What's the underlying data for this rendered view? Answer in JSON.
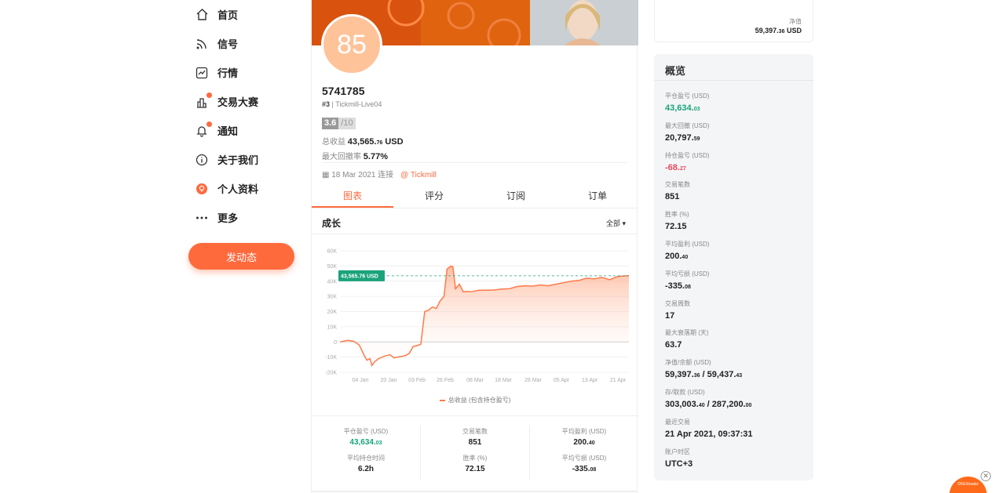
{
  "nav": {
    "items": [
      {
        "label": "首页",
        "icon": "home-icon"
      },
      {
        "label": "信号",
        "icon": "rss-icon"
      },
      {
        "label": "行情",
        "icon": "chart-icon"
      },
      {
        "label": "交易大赛",
        "icon": "trophy-icon"
      },
      {
        "label": "通知",
        "icon": "bell-icon"
      },
      {
        "label": "关于我们",
        "icon": "info-icon"
      },
      {
        "label": "个人资料",
        "icon": "profile-icon"
      },
      {
        "label": "更多",
        "icon": "more-icon"
      }
    ],
    "post_button": "发动态"
  },
  "profile": {
    "score_avatar": "85",
    "account_id": "5741785",
    "rank": "#3",
    "server": "Tickmill-Live04",
    "rating": "3.6",
    "rating_max": "/10",
    "total_profit_label": "总收益",
    "total_profit_int": "43,565.",
    "total_profit_dec": "76",
    "total_profit_unit": "USD",
    "max_drawdown_label": "最大回撤率",
    "max_drawdown": "5.77%",
    "joined_date": "18 Mar 2021 连接",
    "broker": "@ Tickmill"
  },
  "tabs": [
    "图表",
    "评分",
    "订阅",
    "订单"
  ],
  "growth": {
    "title": "成长",
    "range": "全部 ▾",
    "legend": "总收益 (包含持仓盈亏)"
  },
  "chart_data": {
    "type": "area",
    "title": "",
    "xlabel": "",
    "ylabel": "",
    "x_ticks": [
      "04 Jan",
      "20 Jan",
      "03 Feb",
      "26 Feb",
      "08 Mar",
      "18 Mar",
      "26 Mar",
      "05 Apr",
      "13 Apr",
      "21 Apr"
    ],
    "y_ticks": [
      "60K",
      "50K",
      "40K",
      "30K",
      "20K",
      "10K",
      "0",
      "-10K",
      "-20K"
    ],
    "ylim": [
      -20000,
      60000
    ],
    "current_label": "43,565.76 USD",
    "current_value": 43565.76,
    "series": [
      {
        "name": "总收益 (包含持仓盈亏)",
        "color": "#ff7a4a",
        "x": [
          0,
          2,
          3.5,
          5,
          6.5,
          7,
          7.8,
          8.3,
          9,
          10,
          11,
          12,
          13,
          14,
          15,
          16,
          17,
          18,
          19,
          20,
          21,
          22,
          23,
          24,
          25,
          26,
          27,
          27.8,
          28.3,
          28.8,
          29.3,
          30,
          31,
          32,
          33,
          34,
          35,
          36,
          38,
          40,
          42,
          44,
          46,
          48,
          50,
          52,
          54,
          56,
          58,
          60,
          62,
          64,
          66,
          68,
          70,
          72,
          74,
          75
        ],
        "values": [
          0,
          1000,
          500,
          -2000,
          -10000,
          -12000,
          -11000,
          -15500,
          -13000,
          -11000,
          -10000,
          -9000,
          -8500,
          -10500,
          -10000,
          -9500,
          -9000,
          -7500,
          -3000,
          -2500,
          -1500,
          20000,
          21000,
          23000,
          22000,
          27000,
          30000,
          48000,
          49000,
          50000,
          49500,
          35000,
          38000,
          33000,
          33200,
          33000,
          33500,
          34000,
          34100,
          34200,
          34800,
          35000,
          36500,
          37000,
          36800,
          37500,
          37000,
          38000,
          39000,
          40000,
          40500,
          42000,
          41500,
          42500,
          41000,
          43000,
          43500,
          43565.76
        ]
      }
    ]
  },
  "summary": [
    {
      "label": "平仓盈亏 (USD)",
      "int": "43,634.",
      "dec": "03",
      "color": "green"
    },
    {
      "label": "交易笔数",
      "int": "851",
      "dec": "",
      "color": ""
    },
    {
      "label": "平均盈利 (USD)",
      "int": "200.",
      "dec": "40",
      "color": ""
    },
    {
      "label": "平均持仓时间",
      "int": "6.2h",
      "dec": "",
      "color": ""
    },
    {
      "label": "胜率 (%)",
      "int": "72.15",
      "dec": "",
      "color": ""
    },
    {
      "label": "平均亏损 (USD)",
      "int": "-335.",
      "dec": "08",
      "color": ""
    }
  ],
  "net_value": {
    "label": "净值",
    "int": "59,397.",
    "dec": "36",
    "unit": "USD"
  },
  "overview": {
    "title": "概览",
    "items": [
      {
        "label": "平仓盈亏 (USD)",
        "int": "43,634.",
        "dec": "03",
        "color": "green"
      },
      {
        "label": "最大回撤 (USD)",
        "int": "20,797.",
        "dec": "59",
        "color": ""
      },
      {
        "label": "持仓盈亏 (USD)",
        "int": "-68.",
        "dec": "27",
        "color": "red"
      },
      {
        "label": "交易笔数",
        "int": "851",
        "dec": "",
        "color": ""
      },
      {
        "label": "胜率 (%)",
        "int": "72.15",
        "dec": "",
        "color": ""
      },
      {
        "label": "平均盈利 (USD)",
        "int": "200.",
        "dec": "40",
        "color": ""
      },
      {
        "label": "平均亏损 (USD)",
        "int": "-335.",
        "dec": "08",
        "color": ""
      },
      {
        "label": "交易周数",
        "int": "17",
        "dec": "",
        "color": ""
      },
      {
        "label": "最大衰落期 (天)",
        "int": "63.7",
        "dec": "",
        "color": ""
      },
      {
        "label": "净值/余额 (USD)",
        "int": "59,397.",
        "dec": "36",
        "int2": " / 59,437.",
        "dec2": "43",
        "color": ""
      },
      {
        "label": "存/取款 (USD)",
        "int": "303,003.",
        "dec": "40",
        "int2": " / 287,200.",
        "dec2": "00",
        "color": ""
      },
      {
        "label": "最近交易",
        "int": "21 Apr 2021, 09:37:31",
        "dec": "",
        "color": ""
      },
      {
        "label": "账户时区",
        "int": "UTC+3",
        "dec": "",
        "color": ""
      }
    ]
  },
  "widget": {
    "brand": "OKEXtrader",
    "close": "✕"
  }
}
